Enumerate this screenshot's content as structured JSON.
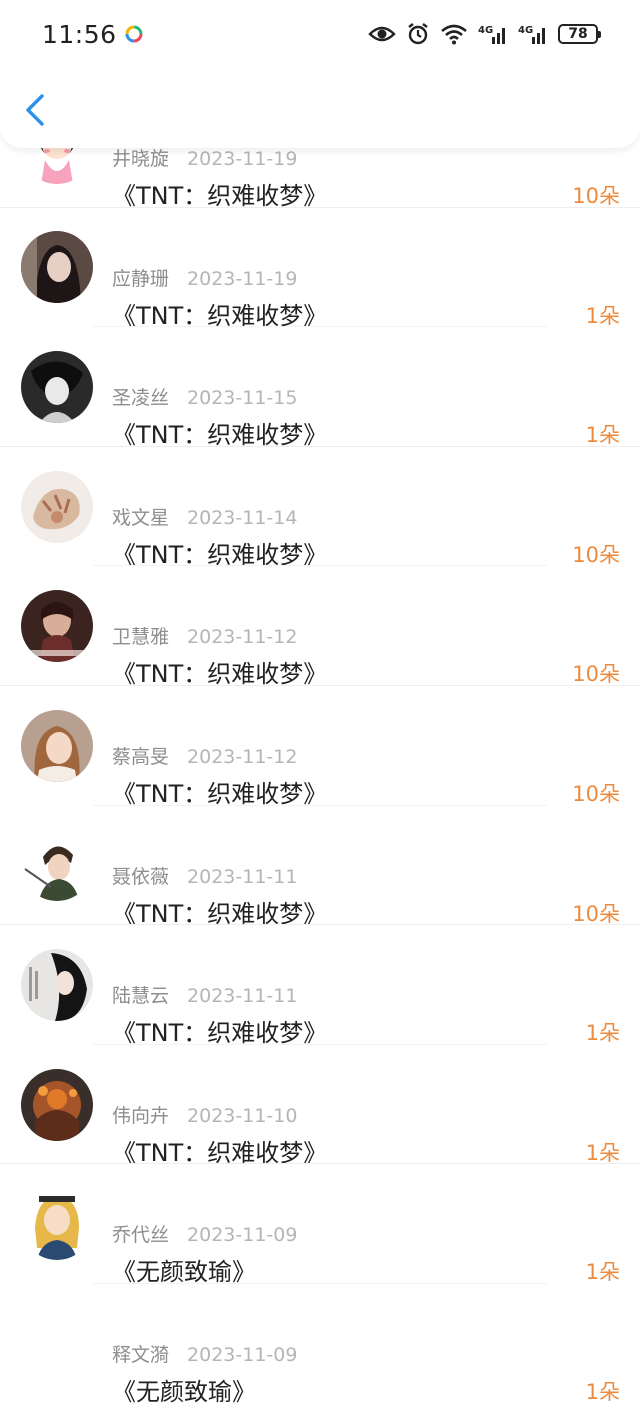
{
  "status_bar": {
    "time": "11:56",
    "battery": "78",
    "icons": [
      "app-badge-icon",
      "eye-icon",
      "alarm-icon",
      "wifi-icon",
      "4g-signal-icon",
      "4g-signal-icon",
      "battery-icon"
    ]
  },
  "header": {
    "back_icon": "chevron-left-icon",
    "accent_color": "#2e90e8"
  },
  "rows": [
    {
      "name": "井晓旋",
      "date": "2023-11-19",
      "title": "《TNT：织难收梦》",
      "count": "10朵"
    },
    {
      "name": "应静珊",
      "date": "2023-11-19",
      "title": "《TNT：织难收梦》",
      "count": "1朵"
    },
    {
      "name": "圣凌丝",
      "date": "2023-11-15",
      "title": "《TNT：织难收梦》",
      "count": "1朵"
    },
    {
      "name": "戏文星",
      "date": "2023-11-14",
      "title": "《TNT：织难收梦》",
      "count": "10朵"
    },
    {
      "name": "卫慧雅",
      "date": "2023-11-12",
      "title": "《TNT：织难收梦》",
      "count": "10朵"
    },
    {
      "name": "蔡高旻",
      "date": "2023-11-12",
      "title": "《TNT：织难收梦》",
      "count": "10朵"
    },
    {
      "name": "聂依薇",
      "date": "2023-11-11",
      "title": "《TNT：织难收梦》",
      "count": "10朵"
    },
    {
      "name": "陆慧云",
      "date": "2023-11-11",
      "title": "《TNT：织难收梦》",
      "count": "1朵"
    },
    {
      "name": "伟向卉",
      "date": "2023-11-10",
      "title": "《TNT：织难收梦》",
      "count": "1朵"
    },
    {
      "name": "乔代丝",
      "date": "2023-11-09",
      "title": "《无颜致瑜》",
      "count": "1朵"
    },
    {
      "name": "释文漪",
      "date": "2023-11-09",
      "title": "《无颜致瑜》",
      "count": "1朵"
    }
  ],
  "colors": {
    "count_accent": "#ee8a3c",
    "name_text": "#8e8e8e",
    "date_text": "#b5b5b5",
    "title_text": "#222222"
  }
}
